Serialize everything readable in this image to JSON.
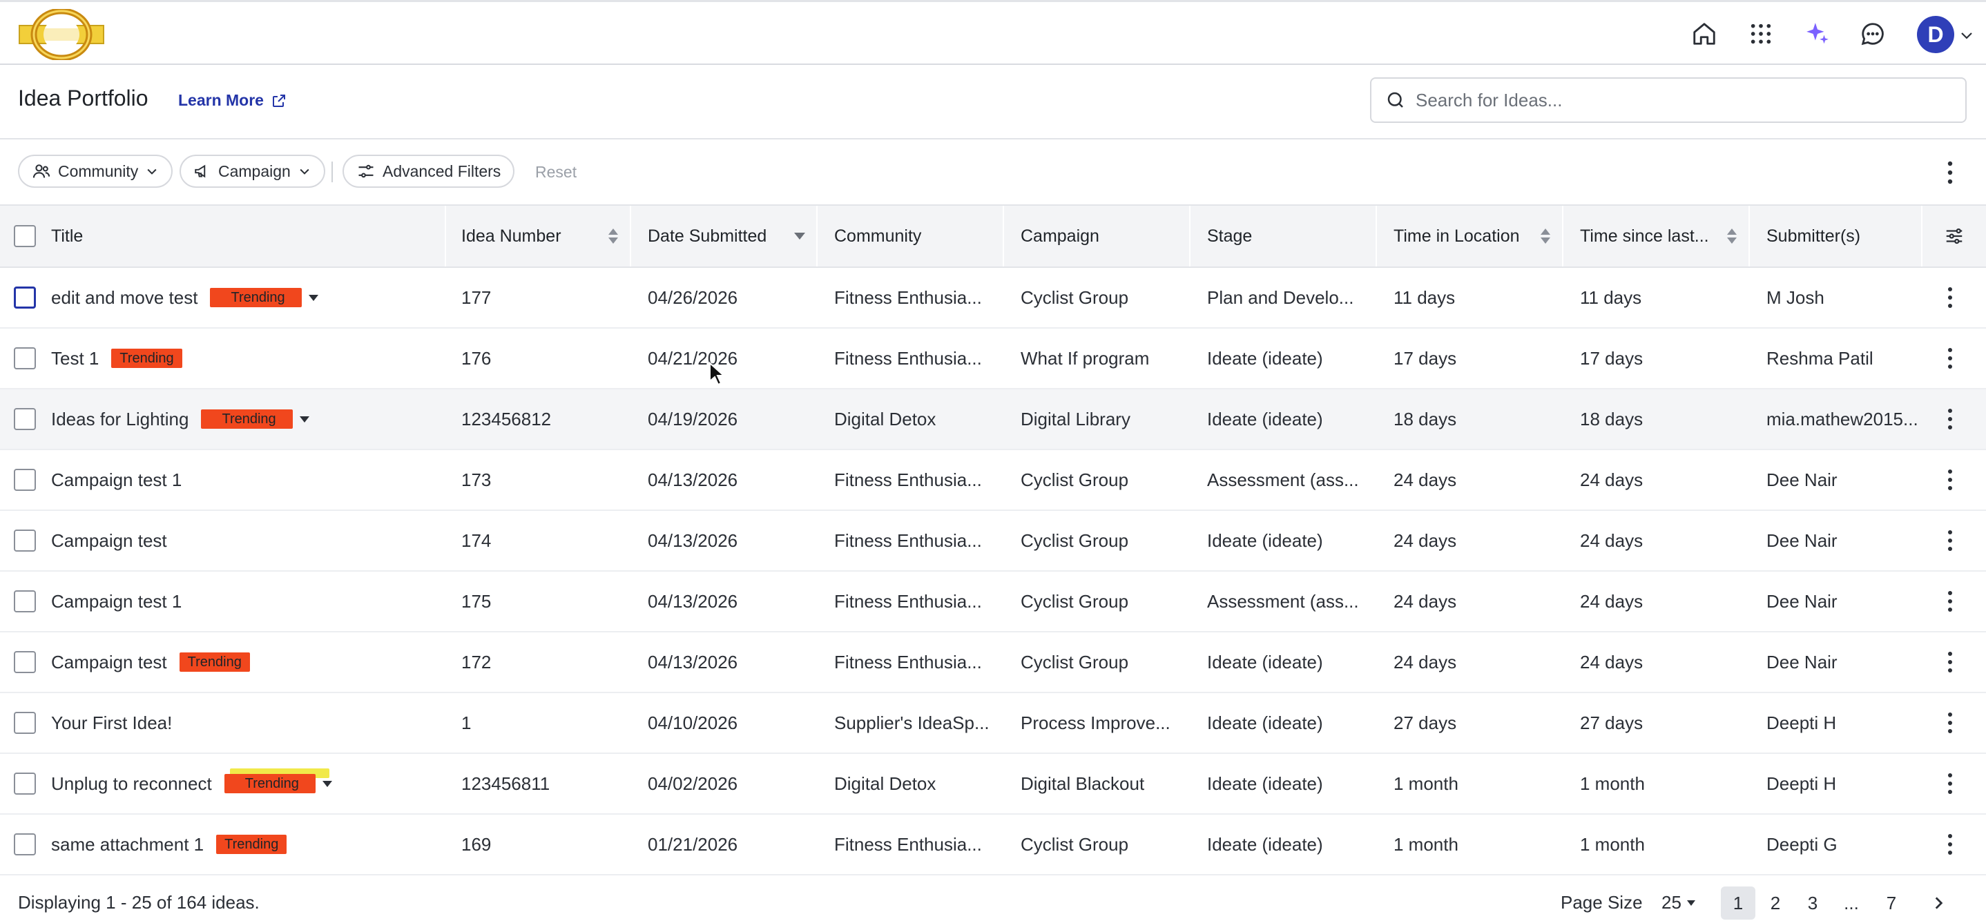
{
  "header": {
    "title": "Idea Portfolio",
    "learn_more": "Learn More",
    "search_placeholder": "Search for Ideas..."
  },
  "user": {
    "avatar_initial": "D"
  },
  "top_icons": [
    "home-icon",
    "apps-grid-icon",
    "sparkle-icon",
    "chat-icon"
  ],
  "colors": {
    "accent": "#2435a8",
    "avatar": "#2f3fb8",
    "trending_badge": "#f1471d",
    "sparkle": "#7b61ff"
  },
  "filters": {
    "community": "Community",
    "campaign": "Campaign",
    "advanced": "Advanced Filters",
    "reset": "Reset"
  },
  "table": {
    "columns": [
      "Title",
      "Idea Number",
      "Date Submitted",
      "Community",
      "Campaign",
      "Stage",
      "Time in Location",
      "Time since last...",
      "Submitter(s)"
    ],
    "rows": [
      {
        "title": "edit and move test",
        "trending": "Trending",
        "dropdown": true,
        "number": "177",
        "date": "04/26/2026",
        "community": "Fitness Enthusia...",
        "campaign": "Cyclist Group",
        "stage": "Plan and Develo...",
        "time_loc": "11 days",
        "time_last": "11 days",
        "submitter": "M Josh"
      },
      {
        "title": "Test 1",
        "trending": "Trending",
        "dropdown": false,
        "number": "176",
        "date": "04/21/2026",
        "community": "Fitness Enthusia...",
        "campaign": "What If program",
        "stage": "Ideate (ideate)",
        "time_loc": "17 days",
        "time_last": "17 days",
        "submitter": "Reshma Patil"
      },
      {
        "title": "Ideas for Lighting",
        "trending": "Trending",
        "dropdown": true,
        "number": "123456812",
        "date": "04/19/2026",
        "community": "Digital Detox",
        "campaign": "Digital Library",
        "stage": "Ideate (ideate)",
        "time_loc": "18 days",
        "time_last": "18 days",
        "submitter": "mia.mathew2015..."
      },
      {
        "title": "Campaign test 1",
        "trending": "",
        "dropdown": false,
        "number": "173",
        "date": "04/13/2026",
        "community": "Fitness Enthusia...",
        "campaign": "Cyclist Group",
        "stage": "Assessment (ass...",
        "time_loc": "24 days",
        "time_last": "24 days",
        "submitter": "Dee Nair"
      },
      {
        "title": "Campaign test",
        "trending": "",
        "dropdown": false,
        "number": "174",
        "date": "04/13/2026",
        "community": "Fitness Enthusia...",
        "campaign": "Cyclist Group",
        "stage": "Ideate (ideate)",
        "time_loc": "24 days",
        "time_last": "24 days",
        "submitter": "Dee Nair"
      },
      {
        "title": "Campaign test 1",
        "trending": "",
        "dropdown": false,
        "number": "175",
        "date": "04/13/2026",
        "community": "Fitness Enthusia...",
        "campaign": "Cyclist Group",
        "stage": "Assessment (ass...",
        "time_loc": "24 days",
        "time_last": "24 days",
        "submitter": "Dee Nair"
      },
      {
        "title": "Campaign test",
        "trending": "Trending",
        "dropdown": false,
        "number": "172",
        "date": "04/13/2026",
        "community": "Fitness Enthusia...",
        "campaign": "Cyclist Group",
        "stage": "Ideate (ideate)",
        "time_loc": "24 days",
        "time_last": "24 days",
        "submitter": "Dee Nair"
      },
      {
        "title": "Your First Idea!",
        "trending": "",
        "dropdown": false,
        "number": "1",
        "date": "04/10/2026",
        "community": "Supplier's IdeaSp...",
        "campaign": "Process Improve...",
        "stage": "Ideate (ideate)",
        "time_loc": "27 days",
        "time_last": "27 days",
        "submitter": "Deepti H"
      },
      {
        "title": "Unplug to reconnect",
        "trending": "Trending",
        "dropdown": true,
        "number": "123456811",
        "date": "04/02/2026",
        "community": "Digital Detox",
        "campaign": "Digital Blackout",
        "stage": "Ideate (ideate)",
        "time_loc": "1 month",
        "time_last": "1 month",
        "submitter": "Deepti H"
      },
      {
        "title": "same attachment 1",
        "trending": "Trending",
        "dropdown": false,
        "number": "169",
        "date": "01/21/2026",
        "community": "Fitness Enthusia...",
        "campaign": "Cyclist Group",
        "stage": "Ideate (ideate)",
        "time_loc": "1 month",
        "time_last": "1 month",
        "submitter": "Deepti G"
      }
    ]
  },
  "footer": {
    "displaying": "Displaying 1 - 25 of 164 ideas.",
    "page_size_label": "Page Size",
    "page_size": "25",
    "pages": [
      "1",
      "2",
      "3",
      "...",
      "7"
    ],
    "current_page": "1"
  }
}
